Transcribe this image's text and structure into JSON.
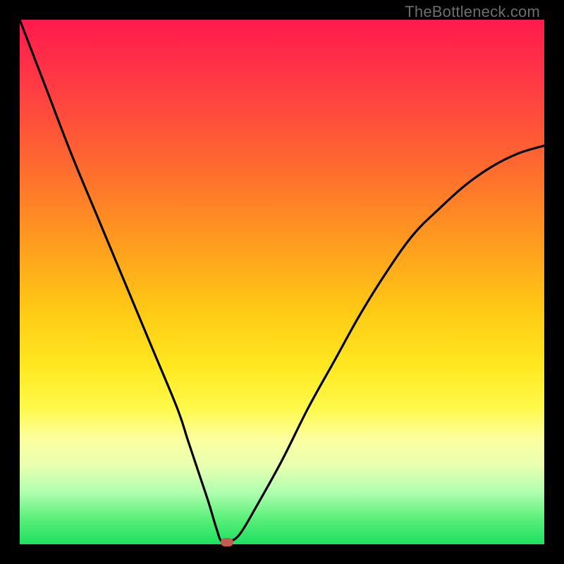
{
  "attribution": "TheBottleneck.com",
  "colors": {
    "frame": "#000000",
    "curve": "#000000",
    "marker": "#c65b52",
    "gradient_top": "#ff1a4d",
    "gradient_bottom": "#1ee060"
  },
  "chart_data": {
    "type": "line",
    "title": "",
    "xlabel": "",
    "ylabel": "",
    "xlim": [
      0,
      100
    ],
    "ylim": [
      0,
      100
    ],
    "grid": false,
    "legend_position": "none",
    "series": [
      {
        "name": "bottleneck-curve",
        "x": [
          0,
          5,
          10,
          15,
          20,
          25,
          30,
          32,
          34,
          36,
          37.5,
          38.5,
          40,
          42,
          45,
          50,
          55,
          60,
          65,
          70,
          75,
          80,
          85,
          90,
          95,
          100
        ],
        "values": [
          100,
          87,
          74,
          62,
          50,
          38,
          26,
          20,
          14,
          8,
          3,
          0.5,
          0.5,
          2,
          7,
          16,
          26,
          35,
          44,
          52,
          59,
          64,
          68.5,
          72,
          74.5,
          76
        ]
      }
    ],
    "annotations": [
      {
        "name": "optimal-marker",
        "x": 39.5,
        "y": 0.4
      }
    ]
  }
}
